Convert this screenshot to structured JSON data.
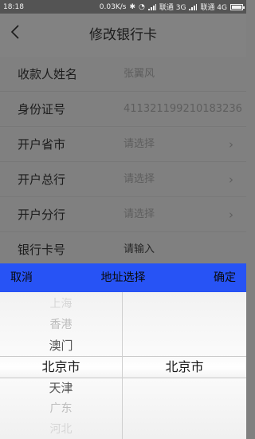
{
  "status_bar": {
    "time": "18:18",
    "speed": "0.03K/s",
    "carrier1": "联通 3G",
    "carrier2": "联通 4G"
  },
  "header": {
    "title": "修改银行卡",
    "back_icon": "chevron-left-icon"
  },
  "form": {
    "rows": [
      {
        "label": "收款人姓名",
        "value": "张翼风",
        "chevron": false
      },
      {
        "label": "身份证号",
        "value": "411321199210183236",
        "chevron": false
      },
      {
        "label": "开户省市",
        "value": "请选择",
        "chevron": true
      },
      {
        "label": "开户总行",
        "value": "请选择",
        "chevron": true
      },
      {
        "label": "开户分行",
        "value": "请选择",
        "chevron": true
      },
      {
        "label": "银行卡号",
        "value": "请输入",
        "chevron": false
      }
    ]
  },
  "picker_bar": {
    "cancel": "取消",
    "title": "地址选择",
    "confirm": "确定",
    "background": "#2753f5"
  },
  "picker": {
    "provinces": [
      "上海",
      "香港",
      "澳门",
      "北京市",
      "天津",
      "广东",
      "河北"
    ],
    "selected_province": "北京市",
    "selected_city": "北京市"
  }
}
